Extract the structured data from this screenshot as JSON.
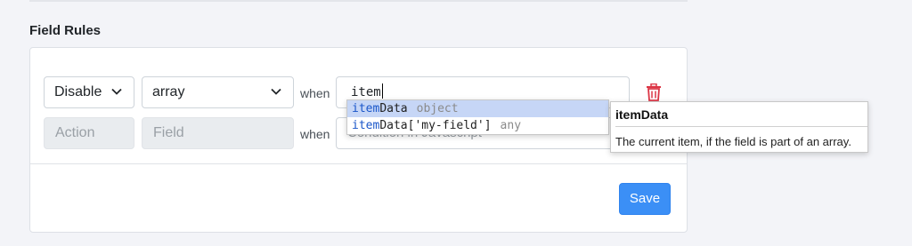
{
  "section": {
    "title": "Field Rules"
  },
  "rules": [
    {
      "action": "Disable",
      "field": "array",
      "when": "when",
      "condition": "item"
    },
    {
      "action_placeholder": "Action",
      "field_placeholder": "Field",
      "when": "when",
      "condition_placeholder": "Condition in Javascript"
    }
  ],
  "autocomplete": {
    "items": [
      {
        "match": "item",
        "rest": "Data",
        "type": "object",
        "selected": true
      },
      {
        "match": "item",
        "rest": "Data['my-field']",
        "type": "any",
        "selected": false
      }
    ],
    "detail": {
      "title": "itemData",
      "description": "The current item, if the field is part of an array."
    }
  },
  "footer": {
    "save_label": "Save"
  },
  "colors": {
    "primary": "#3b8ff6",
    "danger": "#dc3545",
    "selection": "#c6d6f6"
  }
}
